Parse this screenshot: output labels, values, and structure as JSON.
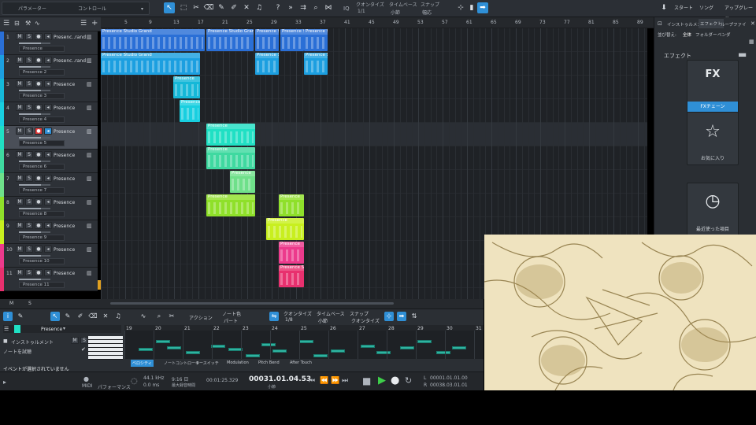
{
  "topbar": {
    "param_label": "パラメーター",
    "control_label": "コントロール",
    "quantize_label": "クオンタイズ",
    "quantize_value": "1/1",
    "timebase_label": "タイムベース",
    "timebase_value": "小節",
    "snap_label": "スナップ",
    "snap_value": "幅応",
    "iq_label": "IQ",
    "start_tab": "スタート",
    "song_tab": "ソング",
    "upgrade_tab": "アップグレード"
  },
  "ruler": [
    "5",
    "9",
    "13",
    "17",
    "21",
    "25",
    "29",
    "33",
    "37",
    "41",
    "45",
    "49",
    "53",
    "57",
    "61",
    "65",
    "69",
    "73",
    "77",
    "81",
    "85",
    "89"
  ],
  "tracks": [
    {
      "num": "1",
      "name": "Presenc..rand",
      "inst": "Presence",
      "color": "#2a6fd6"
    },
    {
      "num": "2",
      "name": "Presenc..rand",
      "inst": "Presence 2",
      "color": "#1c9fe0"
    },
    {
      "num": "3",
      "name": "Presence",
      "inst": "Presence 3",
      "color": "#15b8d8"
    },
    {
      "num": "4",
      "name": "Presence",
      "inst": "Presence 4",
      "color": "#18cfe0"
    },
    {
      "num": "5",
      "name": "Presence",
      "inst": "Presence 5",
      "color": "#20e0c4"
    },
    {
      "num": "6",
      "name": "Presence",
      "inst": "Presence 6",
      "color": "#3fd9a0"
    },
    {
      "num": "7",
      "name": "Presence",
      "inst": "Presence 7",
      "color": "#6fe08a"
    },
    {
      "num": "8",
      "name": "Presence",
      "inst": "Presence 8",
      "color": "#8fe02a"
    },
    {
      "num": "9",
      "name": "Presence",
      "inst": "Presence 9",
      "color": "#c8ef1f"
    },
    {
      "num": "10",
      "name": "Presence",
      "inst": "Presence 10",
      "color": "#ec3a8c"
    },
    {
      "num": "11",
      "name": "Presence",
      "inst": "Presence 11",
      "color": "#e8306e"
    }
  ],
  "track_buttons": {
    "m": "M",
    "s": "S"
  },
  "clips": [
    {
      "row": 0,
      "label": "Presence Studio Grand",
      "start": 0,
      "len": 132,
      "color": "#2a6fd6"
    },
    {
      "row": 0,
      "label": "Presence Studio Grand",
      "start": 134,
      "len": 60,
      "color": "#2a6fd6"
    },
    {
      "row": 0,
      "label": "Presence S",
      "start": 196,
      "len": 30,
      "color": "#2a6fd6"
    },
    {
      "row": 0,
      "label": "Presence S",
      "start": 228,
      "len": 30,
      "color": "#2a6fd6"
    },
    {
      "row": 0,
      "label": "Presence S",
      "start": 258,
      "len": 30,
      "color": "#2a6fd6"
    },
    {
      "row": 1,
      "label": "Presence Studio Grand",
      "start": 0,
      "len": 126,
      "color": "#1c9fe0"
    },
    {
      "row": 1,
      "label": "Presence S",
      "start": 196,
      "len": 30,
      "color": "#1c9fe0"
    },
    {
      "row": 1,
      "label": "Presence S",
      "start": 258,
      "len": 30,
      "color": "#1c9fe0"
    },
    {
      "row": 2,
      "label": "Presence",
      "start": 92,
      "len": 34,
      "color": "#15b8d8"
    },
    {
      "row": 3,
      "label": "Presence",
      "start": 100,
      "len": 26,
      "color": "#18cfe0"
    },
    {
      "row": 4,
      "label": "Presence",
      "start": 134,
      "len": 62,
      "color": "#20e0c4"
    },
    {
      "row": 5,
      "label": "Presence",
      "start": 134,
      "len": 62,
      "color": "#3fd9a0"
    },
    {
      "row": 6,
      "label": "Presence",
      "start": 164,
      "len": 32,
      "color": "#6fe08a"
    },
    {
      "row": 7,
      "label": "Presence",
      "start": 134,
      "len": 62,
      "color": "#8fe02a"
    },
    {
      "row": 7,
      "label": "Presence",
      "start": 226,
      "len": 32,
      "color": "#8fe02a"
    },
    {
      "row": 8,
      "label": "Presence",
      "start": 210,
      "len": 48,
      "color": "#c8ef1f"
    },
    {
      "row": 9,
      "label": "Presence",
      "start": 226,
      "len": 32,
      "color": "#ec3a8c"
    },
    {
      "row": 10,
      "label": "Presence S",
      "start": 226,
      "len": 32,
      "color": "#e8306e"
    }
  ],
  "sidebar": {
    "tab_instruments": "インストゥルメント",
    "tab_effects": "エフェクト",
    "tab_loops": "ループ",
    "tab_files": "ファイ",
    "sort_label": "並び替え:",
    "filter_all": "全体",
    "filter_folder": "フォルダー",
    "filter_vendor": "ベンダ",
    "section_title": "エフェクト",
    "cards": [
      {
        "icon": "FX",
        "label": "FXチェーン"
      },
      {
        "icon": "☆",
        "label": "お気に入り"
      },
      {
        "icon": "◷",
        "label": "最近使った項目"
      }
    ]
  },
  "editor": {
    "instrument_name": "Presence",
    "action_label": "アクション",
    "note_color_label": "ノート色",
    "note_color_value": "パート",
    "quantize_label": "クオンタイズ",
    "quantize_value": "1/8",
    "timebase_label": "タイムベース",
    "timebase_value": "小節",
    "snap_label": "スナップ",
    "snap_value": "クオンタイズ",
    "instrument_row": "インストゥルメント",
    "audition_row": "ノートを試聴",
    "ruler": [
      "19",
      "20",
      "21",
      "22",
      "23",
      "24",
      "25",
      "26",
      "27",
      "28",
      "29",
      "30",
      "31"
    ],
    "lanes": [
      "ベロシティ",
      "ノートコントローラー",
      "キースイッチ",
      "Modulation",
      "Pitch Bend",
      "After Touch"
    ],
    "status": "イベントが選択されていません"
  },
  "transport": {
    "midi_label": "MIDI",
    "perf_label": "パフォーマンス",
    "sample_rate": "44.1 kHz",
    "latency": "0.0 ms",
    "time": "9:16 日",
    "max_rec": "最大録音時間",
    "position_secs": "00:01:25.329",
    "position_bars": "00031.01.04.53",
    "bars_label": "小節",
    "loop_start": "00001.01.01.00",
    "loop_end": "00038.03.01.01",
    "mark_l": "L",
    "mark_r": "R"
  },
  "colors": {
    "accent": "#2f8fd6",
    "record": "#e23b3b",
    "play": "#3ecf4a"
  }
}
